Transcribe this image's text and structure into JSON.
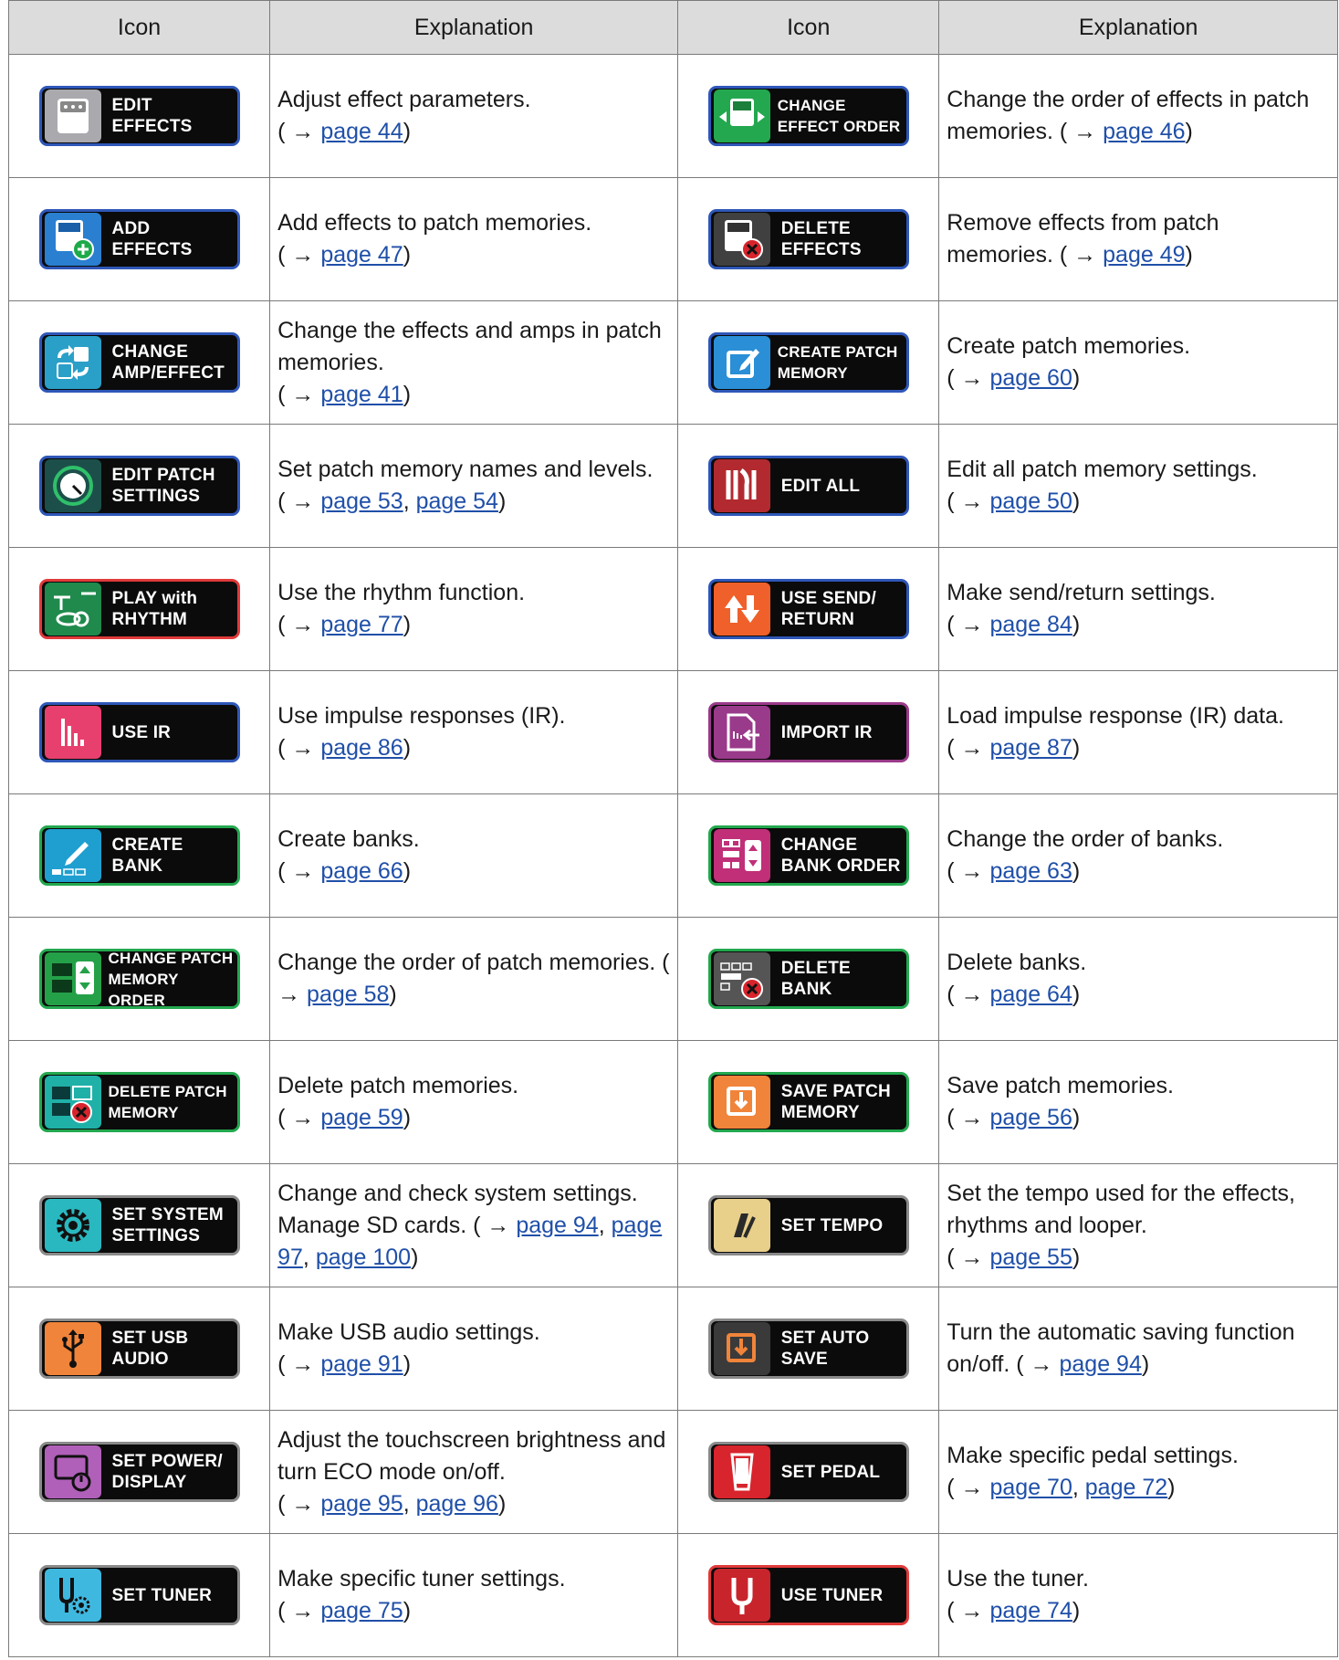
{
  "header": {
    "icon_col": "Icon",
    "explanation_col": "Explanation"
  },
  "rows": [
    {
      "left": {
        "lines": [
          "EDIT",
          "EFFECTS"
        ],
        "icon": "pedal-icon",
        "tile_bg": "#a9a9ae",
        "border": "#2f57b8",
        "text": "Adjust effect parameters.\n( → ",
        "links": [
          "page 44"
        ],
        "tail": ")"
      },
      "right": {
        "lines": [
          "CHANGE",
          "EFFECT ORDER"
        ],
        "icon": "reorder-pedal-icon",
        "tile_bg": "#23a84f",
        "border": "#2f57b8",
        "text": "Change the order of effects in patch memories. ( → ",
        "links": [
          "page 46"
        ],
        "tail": ")"
      }
    },
    {
      "left": {
        "lines": [
          "ADD",
          "EFFECTS"
        ],
        "icon": "add-pedal-icon",
        "tile_bg": "#2a7fd0",
        "border": "#2f57b8",
        "text": "Add effects to patch memories.\n( → ",
        "links": [
          "page 47"
        ],
        "tail": ")"
      },
      "right": {
        "lines": [
          "DELETE",
          "EFFECTS"
        ],
        "icon": "delete-pedal-icon",
        "tile_bg": "#404040",
        "border": "#2f57b8",
        "text": "Remove effects from patch memories. ( → ",
        "links": [
          "page 49"
        ],
        "tail": ")"
      }
    },
    {
      "left": {
        "lines": [
          "CHANGE",
          "AMP/EFFECT"
        ],
        "icon": "swap-icon",
        "tile_bg": "#2aa0c8",
        "border": "#2f57b8",
        "text": "Change the effects and amps in patch memories.\n( → ",
        "links": [
          "page 41"
        ],
        "tail": ")"
      },
      "right": {
        "lines": [
          "CREATE PATCH",
          "MEMORY"
        ],
        "icon": "edit-square-icon",
        "tile_bg": "#2a8fd6",
        "border": "#2f57b8",
        "text": "Create patch memories.\n( → ",
        "links": [
          "page 60"
        ],
        "tail": ")"
      }
    },
    {
      "left": {
        "lines": [
          "EDIT PATCH",
          "SETTINGS"
        ],
        "icon": "knob-icon",
        "tile_bg": "#1c4f4a",
        "border": "#2f57b8",
        "text": "Set patch memory names and levels.\n( → ",
        "links": [
          "page 53",
          "page 54"
        ],
        "tail": ")"
      },
      "right": {
        "lines": [
          "EDIT ALL"
        ],
        "icon": "tools-icon",
        "tile_bg": "#b22a2f",
        "border": "#2f57b8",
        "text": "Edit all patch memory settings.\n( → ",
        "links": [
          "page 50"
        ],
        "tail": ")"
      }
    },
    {
      "left": {
        "lines": [
          "PLAY with",
          "RHYTHM"
        ],
        "icon": "drum-icon",
        "tile_bg": "#1f8a4c",
        "border": "#e03a3a",
        "text": "Use the rhythm function.\n( → ",
        "links": [
          "page 77"
        ],
        "tail": ")"
      },
      "right": {
        "lines": [
          "USE SEND/",
          "RETURN"
        ],
        "icon": "send-return-icon",
        "tile_bg": "#f0602a",
        "border": "#2f57b8",
        "text": "Make send/return settings.\n( → ",
        "links": [
          "page 84"
        ],
        "tail": ")"
      }
    },
    {
      "left": {
        "lines": [
          "USE IR"
        ],
        "icon": "ir-bars-icon",
        "tile_bg": "#e8406e",
        "border": "#2f57b8",
        "text": "Use impulse responses (IR).\n( → ",
        "links": [
          "page 86"
        ],
        "tail": ")"
      },
      "right": {
        "lines": [
          "IMPORT IR"
        ],
        "icon": "import-ir-icon",
        "tile_bg": "#9a3a8a",
        "border": "#9a3a8a",
        "text": "Load impulse response (IR) data.\n( → ",
        "links": [
          "page 87"
        ],
        "tail": ")"
      }
    },
    {
      "left": {
        "lines": [
          "CREATE",
          "BANK"
        ],
        "icon": "create-bank-icon",
        "tile_bg": "#1f9fd0",
        "border": "#23a84f",
        "text": "Create banks.\n( → ",
        "links": [
          "page 66"
        ],
        "tail": ")"
      },
      "right": {
        "lines": [
          "CHANGE",
          "BANK ORDER"
        ],
        "icon": "bank-order-icon",
        "tile_bg": "#c02f78",
        "border": "#23a84f",
        "text": "Change the order of banks.\n( → ",
        "links": [
          "page 63"
        ],
        "tail": ")"
      }
    },
    {
      "left": {
        "lines": [
          "CHANGE PATCH",
          "MEMORY ORDER"
        ],
        "icon": "patch-order-icon",
        "tile_bg": "#24a148",
        "border": "#23a84f",
        "text": "Change the order of patch memories. ( → ",
        "links": [
          "page 58"
        ],
        "tail": ")"
      },
      "right": {
        "lines": [
          "DELETE",
          "BANK"
        ],
        "icon": "delete-bank-icon",
        "tile_bg": "#555555",
        "border": "#23a84f",
        "text": "Delete banks.\n( → ",
        "links": [
          "page 64"
        ],
        "tail": ")"
      }
    },
    {
      "left": {
        "lines": [
          "DELETE PATCH",
          "MEMORY"
        ],
        "icon": "delete-patch-icon",
        "tile_bg": "#1fb0a8",
        "border": "#23a84f",
        "text": "Delete patch memories.\n( → ",
        "links": [
          "page 59"
        ],
        "tail": ")"
      },
      "right": {
        "lines": [
          "SAVE PATCH",
          "MEMORY"
        ],
        "icon": "save-icon",
        "tile_bg": "#f0843a",
        "border": "#23a84f",
        "text": "Save patch memories.\n( → ",
        "links": [
          "page 56"
        ],
        "tail": ")"
      }
    },
    {
      "left": {
        "lines": [
          "SET SYSTEM",
          "SETTINGS"
        ],
        "icon": "gear-icon",
        "tile_bg": "#2ab8c0",
        "border": "#8a8a8a",
        "text": "Change and check system settings. Manage SD cards. ( → ",
        "links": [
          "page 94",
          "page 97",
          "page 100"
        ],
        "tail": ")"
      },
      "right": {
        "lines": [
          "SET TEMPO"
        ],
        "icon": "metronome-icon",
        "tile_bg": "#e8cf8a",
        "border": "#8a8a8a",
        "text": "Set the tempo used for the effects, rhythms and looper.\n( → ",
        "links": [
          "page 55"
        ],
        "tail": ")"
      }
    },
    {
      "left": {
        "lines": [
          "SET USB",
          "AUDIO"
        ],
        "icon": "usb-icon",
        "tile_bg": "#f0843a",
        "border": "#8a8a8a",
        "text": "Make USB audio settings.\n( → ",
        "links": [
          "page 91"
        ],
        "tail": ")"
      },
      "right": {
        "lines": [
          "SET AUTO",
          "SAVE"
        ],
        "icon": "auto-save-icon",
        "tile_bg": "#3a3a3a",
        "border": "#8a8a8a",
        "text": "Turn the automatic saving function on/off. ( → ",
        "links": [
          "page 94"
        ],
        "tail": ")"
      }
    },
    {
      "left": {
        "lines": [
          "SET POWER/",
          "DISPLAY"
        ],
        "icon": "display-power-icon",
        "tile_bg": "#b060b8",
        "border": "#8a8a8a",
        "text": "Adjust the touchscreen brightness and turn ECO mode on/off.\n( → ",
        "links": [
          "page 95",
          "page 96"
        ],
        "tail": ")"
      },
      "right": {
        "lines": [
          "SET PEDAL"
        ],
        "icon": "pedal-expression-icon",
        "tile_bg": "#d8242c",
        "border": "#8a8a8a",
        "text": "Make specific pedal settings.\n( → ",
        "links": [
          "page 70",
          "page 72"
        ],
        "tail": ")"
      }
    },
    {
      "left": {
        "lines": [
          "SET TUNER"
        ],
        "icon": "tuner-settings-icon",
        "tile_bg": "#3fb8e0",
        "border": "#8a8a8a",
        "text": "Make specific tuner settings.\n( → ",
        "links": [
          "page 75"
        ],
        "tail": ")"
      },
      "right": {
        "lines": [
          "USE TUNER"
        ],
        "icon": "tuning-fork-icon",
        "tile_bg": "#c8242c",
        "border": "#e03a3a",
        "text": "Use the tuner.\n( → ",
        "links": [
          "page 74"
        ],
        "tail": ")"
      }
    }
  ]
}
